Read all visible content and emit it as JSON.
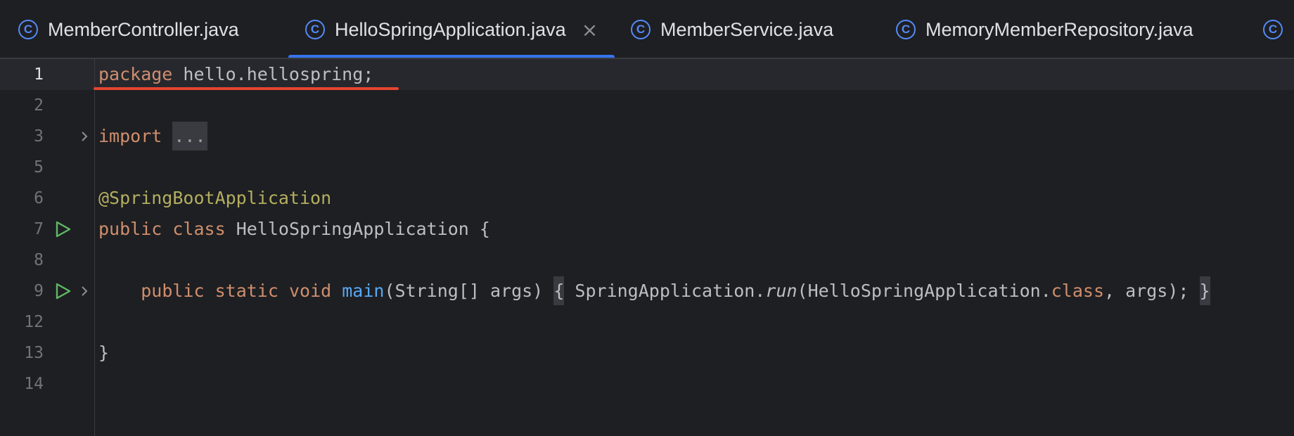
{
  "tabs": [
    {
      "label": "MemberController.java",
      "active": false
    },
    {
      "label": "HelloSpringApplication.java",
      "active": true,
      "close": "×"
    },
    {
      "label": "MemberService.java",
      "active": false
    },
    {
      "label": "MemoryMemberRepository.java",
      "active": false
    },
    {
      "label": "",
      "active": false
    }
  ],
  "tab_icon_glyph": "C",
  "editor": {
    "lines": [
      {
        "number": "1",
        "tokens": {
          "kw": "package",
          "rest": " hello.hellospring;"
        }
      },
      {
        "number": "2"
      },
      {
        "number": "3",
        "tokens": {
          "kw": "import",
          "folded": "..."
        }
      },
      {
        "number": "5"
      },
      {
        "number": "6",
        "tokens": {
          "anno": "@SpringBootApplication"
        }
      },
      {
        "number": "7",
        "tokens": {
          "kw1": "public",
          "kw2": "class",
          "rest": " HelloSpringApplication {"
        }
      },
      {
        "number": "8"
      },
      {
        "number": "9",
        "tokens": {
          "indent": "    ",
          "kw1": "public",
          "kw2": "static",
          "kw3": "void",
          "fn": "main",
          "params": "(String[] args)",
          "open_brace": "{",
          "call_obj": " SpringApplication.",
          "call_method": "run",
          "call_arg_start": "(HelloSpringApplication.",
          "class_kw": "class",
          "call_arg_end": ", args);",
          "close_brace": "}"
        }
      },
      {
        "number": "12"
      },
      {
        "number": "13",
        "tokens": {
          "rest": "}"
        }
      },
      {
        "number": "14"
      }
    ]
  },
  "colors": {
    "background": "#1e1f22",
    "keyword": "#cf8e6d",
    "annotation": "#b3ae60",
    "function": "#56a8f5",
    "accent": "#3574f0",
    "error_underline": "#e5452f",
    "run_icon": "#5fb865"
  },
  "icons": {
    "tab": "class-c-icon",
    "run": "run-play-icon",
    "fold": "chevron-right-icon"
  }
}
